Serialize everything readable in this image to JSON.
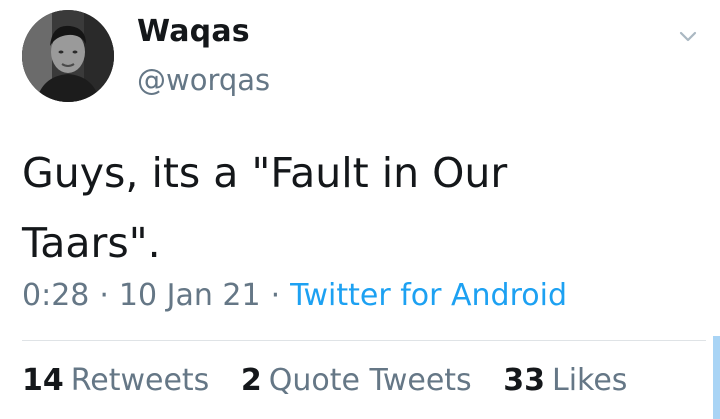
{
  "author": {
    "display_name": "Waqas",
    "handle": "@worqas",
    "avatar_icon": "profile-photo"
  },
  "tweet": {
    "text_line1": "Guys, its a \"Fault in Our",
    "text_line2": "Taars\"."
  },
  "meta": {
    "time": "0:28",
    "date": "10 Jan 21",
    "separator": "·",
    "source": "Twitter for Android"
  },
  "stats": {
    "retweets_count": "14",
    "retweets_label": "Retweets",
    "quotes_count": "2",
    "quotes_label": "Quote Tweets",
    "likes_count": "33",
    "likes_label": "Likes"
  },
  "colors": {
    "text": "#14171a",
    "secondary": "#657786",
    "link": "#1da1f2"
  }
}
